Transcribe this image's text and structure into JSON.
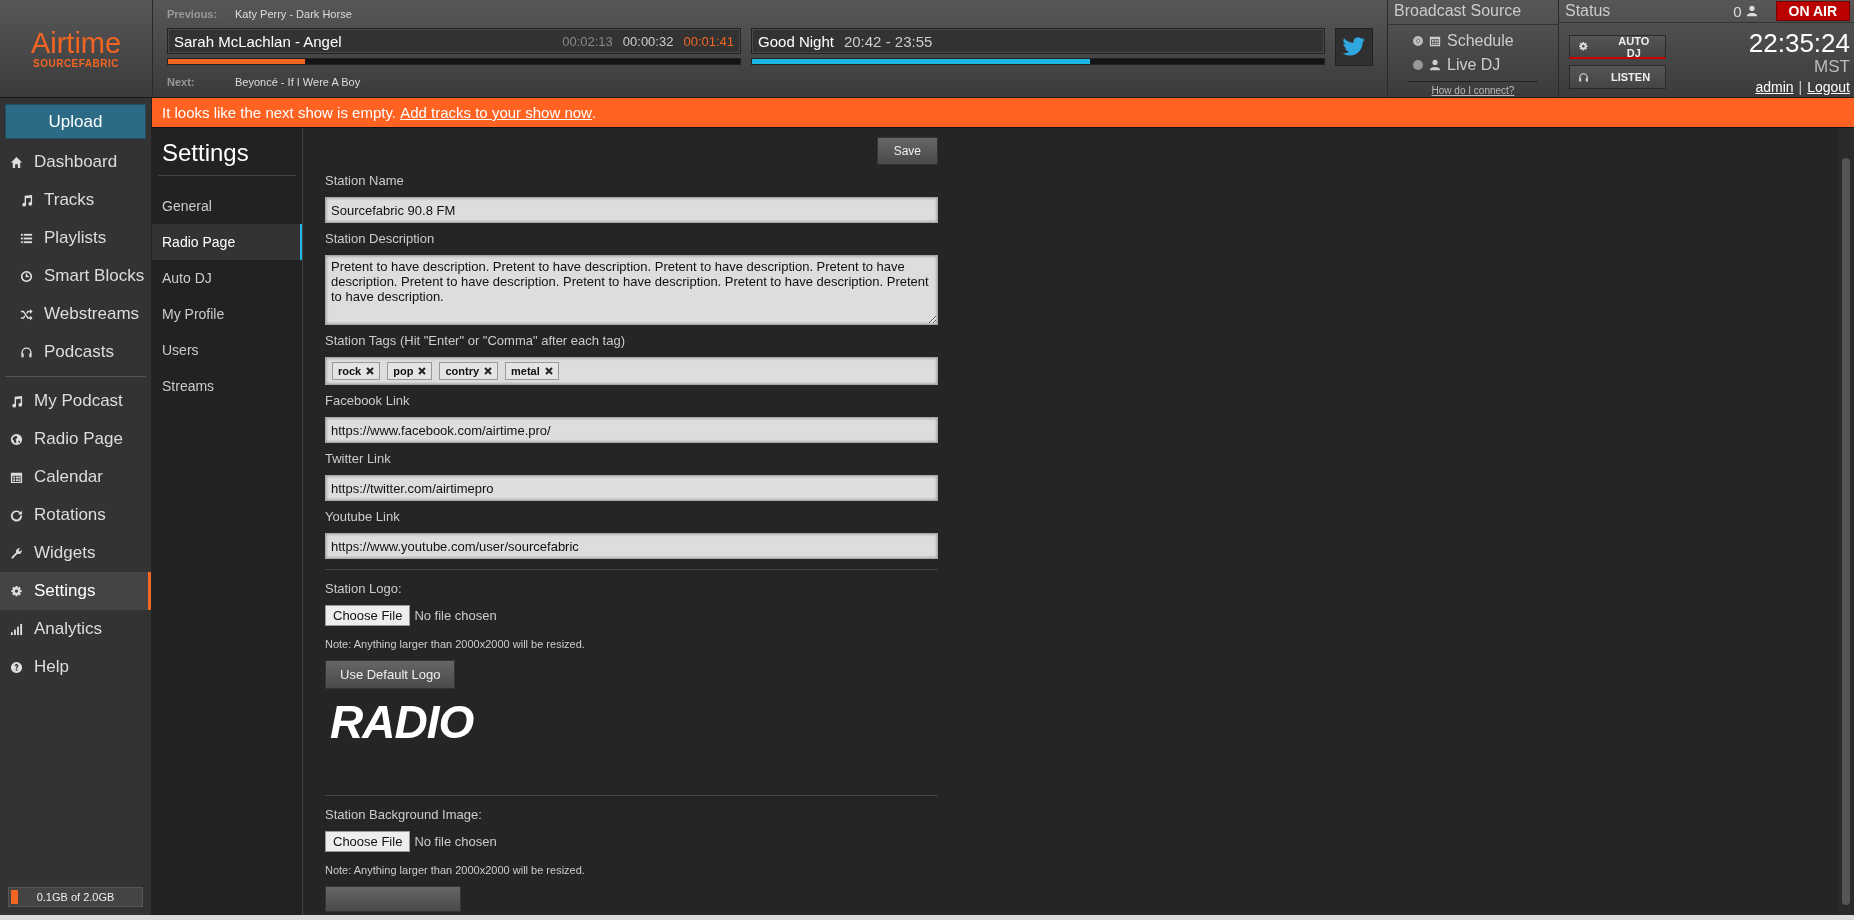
{
  "logo": {
    "name": "Airtime",
    "sub": "SOURCEFABRIC"
  },
  "now_playing": {
    "previous_label": "Previous:",
    "previous": "Katy Perry - Dark Horse",
    "current": "Sarah McLachlan - Angel",
    "elapsed": "00:02:13",
    "remaining": "00:00:32",
    "countdown": "00:01:41",
    "level": 0.24,
    "next_label": "Next:",
    "next": "Beyoncé - If I Were A Boy"
  },
  "show": {
    "name": "Good Night",
    "time": "20:42 - 23:55",
    "level": 0.59
  },
  "broadcast_source": {
    "title": "Broadcast Source",
    "options": [
      {
        "label": "Schedule",
        "selected": true
      },
      {
        "label": "Live DJ",
        "selected": false
      }
    ],
    "help_link": "How do I connect?"
  },
  "status": {
    "title": "Status",
    "listeners": "0",
    "on_air": "ON AIR",
    "auto_dj": "AUTO DJ",
    "listen": "LISTEN",
    "clock": "22:35:24",
    "timezone": "MST",
    "user": "admin",
    "separator": "|",
    "logout": "Logout"
  },
  "sidebar": {
    "upload": "Upload",
    "sections": [
      [
        {
          "label": "Dashboard",
          "selected": false,
          "children": [
            {
              "label": "Tracks",
              "selected": false
            },
            {
              "label": "Playlists",
              "selected": false
            },
            {
              "label": "Smart Blocks",
              "selected": false
            },
            {
              "label": "Webstreams",
              "selected": false
            },
            {
              "label": "Podcasts",
              "selected": false
            }
          ]
        }
      ],
      [
        {
          "label": "My Podcast",
          "selected": false
        },
        {
          "label": "Radio Page",
          "selected": false
        },
        {
          "label": "Calendar",
          "selected": false
        },
        {
          "label": "Rotations",
          "selected": false
        },
        {
          "label": "Widgets",
          "selected": false
        },
        {
          "label": "Settings",
          "selected": true
        },
        {
          "label": "Analytics",
          "selected": false
        },
        {
          "label": "Help",
          "selected": false
        }
      ]
    ],
    "storage": {
      "text": "0.1GB of 2.0GB",
      "level": 0.05
    }
  },
  "banner": {
    "text": "It looks like the next show is empty.",
    "link": "Add tracks to your show now",
    "end": "."
  },
  "settings_nav": {
    "title": "Settings",
    "items": [
      {
        "label": "General",
        "selected": false
      },
      {
        "label": "Radio Page",
        "selected": true
      },
      {
        "label": "Auto DJ",
        "selected": false
      },
      {
        "label": "My Profile",
        "selected": false
      },
      {
        "label": "Users",
        "selected": false
      },
      {
        "label": "Streams",
        "selected": false
      }
    ]
  },
  "form": {
    "save": "Save",
    "fields": [
      {
        "kind": "text",
        "label": "Station Name",
        "value": "Sourcefabric 90.8 FM"
      },
      {
        "kind": "textarea",
        "label": "Station Description",
        "value": "Pretent to have description. Pretent to have description. Pretent to have description. Pretent to have description. Pretent to have description. Pretent to have description. Pretent to have description. Pretent to have description."
      },
      {
        "kind": "tags",
        "label": "Station Tags (Hit \"Enter\" or \"Comma\" after each tag)",
        "tags": [
          "rock",
          "pop",
          "contry",
          "metal"
        ]
      },
      {
        "kind": "text",
        "label": "Facebook Link",
        "value": "https://www.facebook.com/airtime.pro/"
      },
      {
        "kind": "text",
        "label": "Twitter Link",
        "value": "https://twitter.com/airtimepro"
      },
      {
        "kind": "text",
        "label": "Youtube Link",
        "value": "https://www.youtube.com/user/sourcefabric"
      }
    ],
    "uploads": [
      {
        "label": "Station Logo:",
        "file_button": "Choose File",
        "file_status": "No file chosen",
        "note": "Note: Anything larger than 2000x2000 will be resized.",
        "default_button": "Use Default Logo",
        "logo_text": "RADIO"
      },
      {
        "label": "Station Background Image:",
        "file_button": "Choose File",
        "file_status": "No file chosen",
        "note": "Note: Anything larger than 2000x2000 will be resized."
      }
    ]
  }
}
